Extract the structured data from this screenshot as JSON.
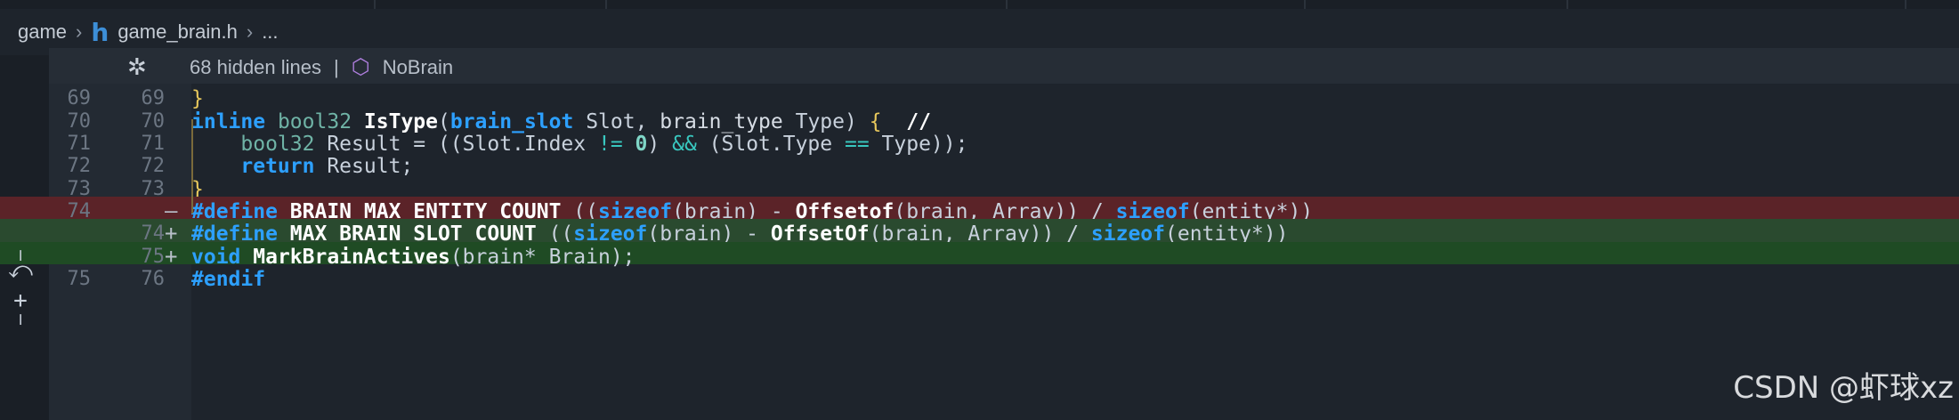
{
  "breadcrumb": {
    "folder": "game",
    "file_icon": "h",
    "file": "game_brain.h",
    "more": "..."
  },
  "hidden_lines": {
    "text": "68 hidden lines",
    "divider": "|",
    "symbol": "NoBrain"
  },
  "lines": [
    {
      "old": "69",
      "new": "69",
      "marker": "",
      "code": "}"
    },
    {
      "old": "70",
      "new": "70",
      "marker": "",
      "code": "inline bool32 IsType(brain_slot Slot, brain_type Type) {  //"
    },
    {
      "old": "71",
      "new": "71",
      "marker": "",
      "code": "    bool32 Result = ((Slot.Index != 0) && (Slot.Type == Type));"
    },
    {
      "old": "72",
      "new": "72",
      "marker": "",
      "code": "    return Result;"
    },
    {
      "old": "73",
      "new": "73",
      "marker": "",
      "code": "}"
    },
    {
      "old": "74",
      "new": "",
      "marker": "—",
      "code": "#define BRAIN_MAX_ENTITY_COUNT ((sizeof(brain) - Offsetof(brain, Array)) / sizeof(entity*))"
    },
    {
      "old": "",
      "new": "74",
      "marker": "+",
      "code": "#define MAX_BRAIN_SLOT_COUNT ((sizeof(brain) - OffsetOf(brain, Array)) / sizeof(entity*))"
    },
    {
      "old": "",
      "new": "75",
      "marker": "+",
      "code": "void MarkBrainActives(brain* Brain);"
    },
    {
      "old": "75",
      "new": "76",
      "marker": "",
      "code": "#endif"
    }
  ],
  "watermark": "CSDN @虾球xz",
  "icons": {
    "unfold": "unfold-icon",
    "symbol": "cube-icon",
    "revert": "revert-icon",
    "stage": "stage-icon"
  },
  "colors": {
    "deleted_line": "#5b2328",
    "added_line": "#2a4a2f",
    "added_line2": "#1f4b24"
  }
}
